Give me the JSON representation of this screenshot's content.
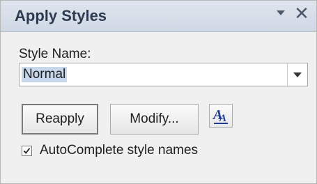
{
  "pane": {
    "title": "Apply Styles",
    "menu_icon": "chevron-down-icon",
    "close_icon": "close-icon",
    "close_glyph": "✕"
  },
  "style_name": {
    "label": "Style Name:",
    "value": "Normal",
    "dropdown_icon": "chevron-down-icon"
  },
  "buttons": {
    "reapply_label": "Reapply",
    "modify_label": "Modify...",
    "style_inspector_icon": "style-inspector-icon",
    "style_inspector_glyph": "A"
  },
  "autocomplete": {
    "checked": true,
    "label": "AutoComplete style names"
  },
  "colors": {
    "title_bar": "#cfd8e4",
    "title_text": "#2b3a4f",
    "selection_highlight": "#c8d8ec",
    "style_inspector_accent": "#1f3b99"
  }
}
